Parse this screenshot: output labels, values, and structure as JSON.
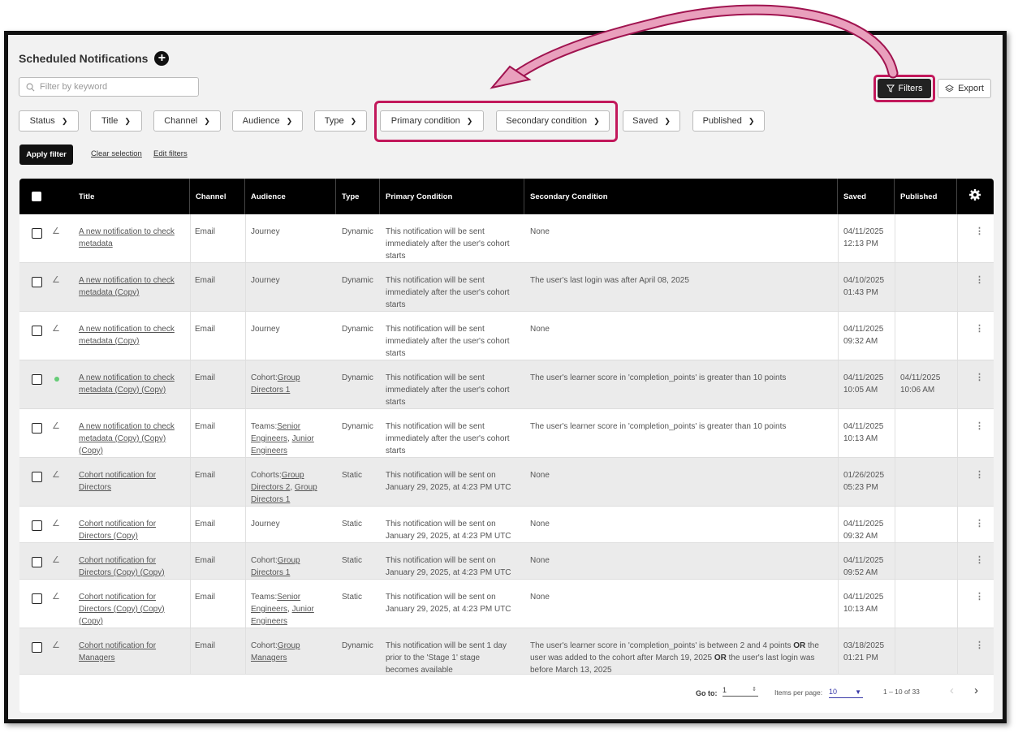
{
  "page": {
    "title": "Scheduled Notifications"
  },
  "search": {
    "placeholder": "Filter by keyword"
  },
  "toolbar": {
    "filters_label": "Filters",
    "export_label": "Export"
  },
  "filters": [
    "Status",
    "Title",
    "Channel",
    "Audience",
    "Type",
    "Primary condition",
    "Secondary condition",
    "Saved",
    "Published"
  ],
  "actions": {
    "apply_label": "Apply filter",
    "clear_label": "Clear selection",
    "edit_label": "Edit filters"
  },
  "table": {
    "headers": [
      "Title",
      "Channel",
      "Audience",
      "Type",
      "Primary Condition",
      "Secondary Condition",
      "Saved",
      "Published"
    ],
    "rows": [
      {
        "title": [
          "A new notification to check",
          "metadata"
        ],
        "channel": "Email",
        "audience": [
          "Journey"
        ],
        "type": "Dynamic",
        "primary": [
          "This notification will be sent",
          "immediately after the user's cohort",
          "starts"
        ],
        "secondary": [
          "None"
        ],
        "saved": [
          "04/11/2025",
          "12:13 PM"
        ],
        "published": [],
        "status_icon": "pencil-icon"
      },
      {
        "title": [
          "A new notification to check",
          "metadata (Copy)"
        ],
        "channel": "Email",
        "audience": [
          "Journey"
        ],
        "type": "Dynamic",
        "primary": [
          "This notification will be sent",
          "immediately after the user's cohort",
          "starts"
        ],
        "secondary": [
          "The user's last login was after April 08, 2025"
        ],
        "saved": [
          "04/10/2025",
          "01:43 PM"
        ],
        "published": [],
        "status_icon": "pencil-icon"
      },
      {
        "title": [
          "A new notification to check",
          "metadata (Copy)"
        ],
        "channel": "Email",
        "audience": [
          "Journey"
        ],
        "type": "Dynamic",
        "primary": [
          "This notification will be sent",
          "immediately after the user's cohort",
          "starts"
        ],
        "secondary": [
          "None"
        ],
        "saved": [
          "04/11/2025",
          "09:32 AM"
        ],
        "published": [],
        "status_icon": "pencil-icon"
      },
      {
        "title": [
          "A new notification to check",
          "metadata (Copy) (Copy)"
        ],
        "channel": "Email",
        "audience": [
          "Cohort:Group",
          "Directors 1"
        ],
        "type": "Dynamic",
        "primary": [
          "This notification will be sent",
          "immediately after the user's cohort",
          "starts"
        ],
        "secondary": [
          "The user's learner score in 'completion_points' is greater than 10 points"
        ],
        "saved": [
          "04/11/2025",
          "10:05 AM"
        ],
        "published": [
          "04/11/2025",
          "10:06 AM"
        ],
        "status_icon": "published-dot-icon"
      },
      {
        "title": [
          "A new notification to check",
          "metadata (Copy) (Copy)",
          "(Copy)"
        ],
        "channel": "Email",
        "audience": [
          "Teams:Senior",
          "Engineers, Junior",
          "Engineers"
        ],
        "type": "Dynamic",
        "primary": [
          "This notification will be sent",
          "immediately after the user's cohort",
          "starts"
        ],
        "secondary": [
          "The user's learner score in 'completion_points' is greater than 10 points"
        ],
        "saved": [
          "04/11/2025",
          "10:13 AM"
        ],
        "published": [],
        "status_icon": "pencil-icon"
      },
      {
        "title": [
          "Cohort notification for",
          "Directors"
        ],
        "channel": "Email",
        "audience": [
          "Cohorts:Group",
          "Directors 2, Group",
          "Directors 1"
        ],
        "type": "Static",
        "primary": [
          "This notification will be sent on",
          "January 29, 2025, at 4:23 PM UTC"
        ],
        "secondary": [
          "None"
        ],
        "saved": [
          "01/26/2025",
          "05:23 PM"
        ],
        "published": [],
        "status_icon": "pencil-icon"
      },
      {
        "title": [
          "Cohort notification for",
          "Directors (Copy)"
        ],
        "channel": "Email",
        "audience": [
          "Journey"
        ],
        "type": "Static",
        "primary": [
          "This notification will be sent on",
          "January 29, 2025, at 4:23 PM UTC"
        ],
        "secondary": [
          "None"
        ],
        "saved": [
          "04/11/2025",
          "09:32 AM"
        ],
        "published": [],
        "status_icon": "pencil-icon"
      },
      {
        "title": [
          "Cohort notification for",
          "Directors (Copy) (Copy)"
        ],
        "channel": "Email",
        "audience": [
          "Cohort:Group",
          "Directors 1"
        ],
        "type": "Static",
        "primary": [
          "This notification will be sent on",
          "January 29, 2025, at 4:23 PM UTC"
        ],
        "secondary": [
          "None"
        ],
        "saved": [
          "04/11/2025",
          "09:52 AM"
        ],
        "published": [],
        "status_icon": "pencil-icon"
      },
      {
        "title": [
          "Cohort notification for",
          "Directors (Copy) (Copy)",
          "(Copy)"
        ],
        "channel": "Email",
        "audience": [
          "Teams:Senior",
          "Engineers, Junior",
          "Engineers"
        ],
        "type": "Static",
        "primary": [
          "This notification will be sent on",
          "January 29, 2025, at 4:23 PM UTC"
        ],
        "secondary": [
          "None"
        ],
        "saved": [
          "04/11/2025",
          "10:13 AM"
        ],
        "published": [],
        "status_icon": "pencil-icon"
      },
      {
        "title": [
          "Cohort notification for",
          "Managers"
        ],
        "channel": "Email",
        "audience": [
          "Cohort:Group",
          "Managers"
        ],
        "type": "Dynamic",
        "primary": [
          "This notification will be sent 1 day",
          "prior to the 'Stage 1' stage",
          "becomes available"
        ],
        "secondary": [
          "The user's learner score in 'completion_points' is between 2 and 4 points OR the",
          "user was added to the cohort after March 19, 2025 OR the user's last login was",
          "before March 13, 2025"
        ],
        "saved": [
          "03/18/2025",
          "01:21 PM"
        ],
        "published": [],
        "status_icon": "pencil-icon"
      }
    ]
  },
  "pagination": {
    "goto_label": "Go to:",
    "goto_value": "1",
    "per_page_label": "Items per page:",
    "per_page_value": "10",
    "range": "1 – 10 of 33"
  },
  "colors": {
    "highlight": "#c2185b",
    "header_bg": "#000000",
    "published_dot": "#66cc77"
  }
}
